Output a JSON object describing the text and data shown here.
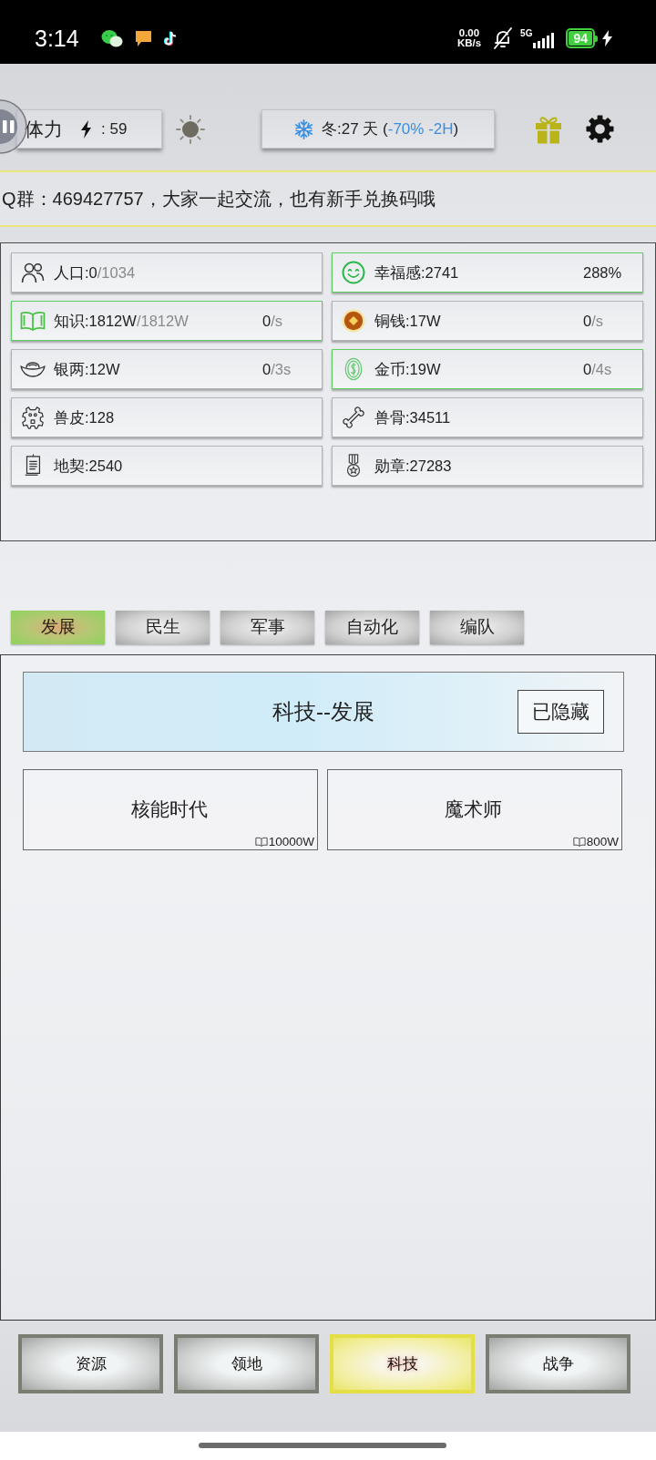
{
  "status_bar": {
    "time": "3:14",
    "net_speed": "0.00",
    "net_unit": "KB/s",
    "network": "5G",
    "battery": "94"
  },
  "top_bar": {
    "stamina_label": "体力",
    "stamina_value": ": 59",
    "season_prefix": "冬:27 天 (",
    "season_modifier": "-70% -2H",
    "season_suffix": ")"
  },
  "notice": "Q群：469427757，大家一起交流，也有新手兑换码哦",
  "resources": [
    {
      "label": "人口:0",
      "cap": "/1034",
      "highlighted": false
    },
    {
      "label": "幸福感:2741",
      "rate": "288%",
      "highlighted": true
    },
    {
      "label": "知识:1812W",
      "cap": "/1812W",
      "rate": "0",
      "rate_unit": "/s",
      "highlighted": true
    },
    {
      "label": "铜钱:17W",
      "rate": "0",
      "rate_unit": "/s",
      "highlighted": false
    },
    {
      "label": "银两:12W",
      "rate": "0",
      "rate_unit": "/3s",
      "highlighted": false
    },
    {
      "label": "金币:19W",
      "rate": "0",
      "rate_unit": "/4s",
      "highlighted": true
    },
    {
      "label": "兽皮:128",
      "highlighted": false
    },
    {
      "label": "兽骨:34511",
      "highlighted": false
    },
    {
      "label": "地契:2540",
      "highlighted": false
    },
    {
      "label": "勋章:27283",
      "highlighted": false
    }
  ],
  "tabs": [
    {
      "label": "发展",
      "selected": true
    },
    {
      "label": "民生",
      "selected": false
    },
    {
      "label": "军事",
      "selected": false
    },
    {
      "label": "自动化",
      "selected": false
    },
    {
      "label": "编队",
      "selected": false
    }
  ],
  "tech_header": {
    "title": "科技--发展",
    "toggle": "已隐藏"
  },
  "techs": [
    {
      "name": "核能时代",
      "cost": "10000W"
    },
    {
      "name": "魔术师",
      "cost": "800W"
    }
  ],
  "bottom_nav": [
    {
      "label": "资源",
      "selected": false
    },
    {
      "label": "领地",
      "selected": false
    },
    {
      "label": "科技",
      "selected": true
    },
    {
      "label": "战争",
      "selected": false
    }
  ]
}
